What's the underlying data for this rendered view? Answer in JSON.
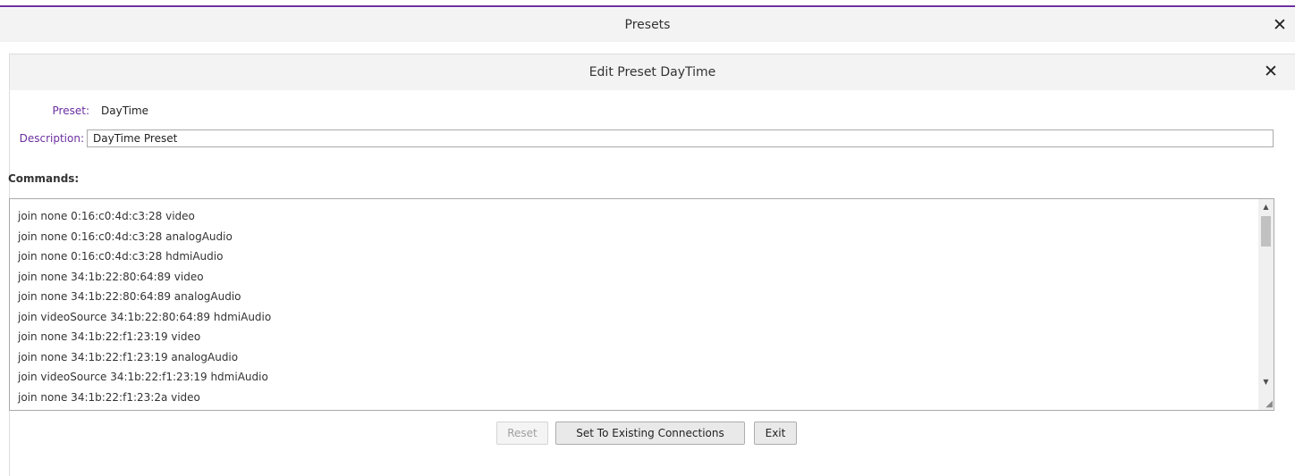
{
  "window": {
    "title": "Presets",
    "close_glyph": "✕"
  },
  "dialog": {
    "title": "Edit Preset DayTime",
    "close_glyph": "✕"
  },
  "form": {
    "preset_label": "Preset:",
    "preset_value": "DayTime",
    "description_label": "Description:",
    "description_value": "DayTime Preset"
  },
  "commands": {
    "heading": "Commands:",
    "lines": [
      "join none 0:16:c0:4d:c3:28 video",
      "join none 0:16:c0:4d:c3:28 analogAudio",
      "join none 0:16:c0:4d:c3:28 hdmiAudio",
      "join none 34:1b:22:80:64:89 video",
      "join none 34:1b:22:80:64:89 analogAudio",
      "join videoSource 34:1b:22:80:64:89 hdmiAudio",
      "join none 34:1b:22:f1:23:19 video",
      "join none 34:1b:22:f1:23:19 analogAudio",
      "join videoSource 34:1b:22:f1:23:19 hdmiAudio",
      "join none 34:1b:22:f1:23:2a video"
    ]
  },
  "buttons": {
    "reset": "Reset",
    "set_existing": "Set To Existing Connections",
    "exit": "Exit"
  },
  "icons": {
    "close": "close-icon",
    "scroll_up": "scroll-up-icon",
    "scroll_down": "scroll-down-icon",
    "resize": "resize-grip-icon"
  },
  "colors": {
    "accent": "#6b2fa0",
    "header_bg": "#f3f3f3"
  }
}
